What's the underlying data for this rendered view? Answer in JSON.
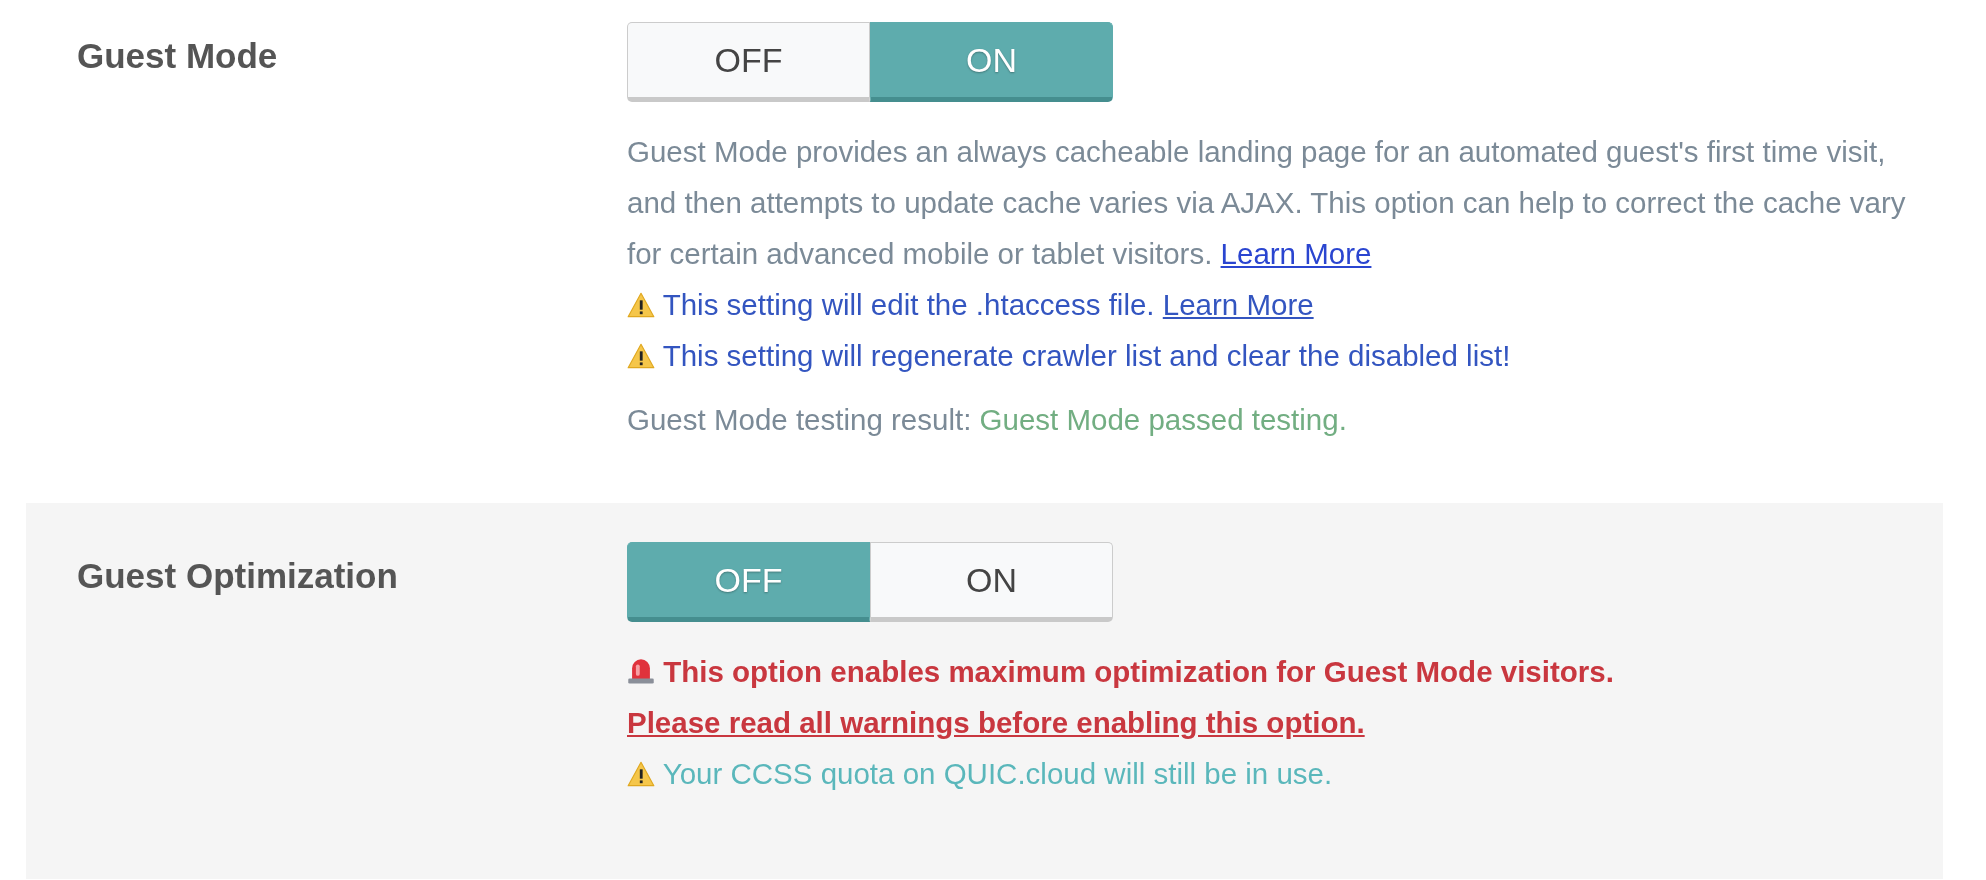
{
  "settings": [
    {
      "label": "Guest Mode",
      "shaded": false,
      "toggle": [
        {
          "label": "OFF",
          "selected": false
        },
        {
          "label": "ON",
          "selected": true
        }
      ],
      "notes": [
        {
          "kind": "description",
          "text": "Guest Mode provides an always cacheable landing page for an automated guest's first time visit, and then attempts to update cache varies via AJAX. This option can help to correct the cache vary for certain advanced mobile or tablet visitors.",
          "link": "Learn More"
        },
        {
          "kind": "warning",
          "text": "This setting will edit the .htaccess file.",
          "link": "Learn More"
        },
        {
          "kind": "warning",
          "text": "This setting will regenerate crawler list and clear the disabled list!"
        },
        {
          "kind": "result",
          "text": "Guest Mode testing result:",
          "value": "Guest Mode passed testing."
        }
      ]
    },
    {
      "label": "Guest Optimization",
      "shaded": true,
      "toggle": [
        {
          "label": "OFF",
          "selected": true
        },
        {
          "label": "ON",
          "selected": false
        }
      ],
      "notes": [
        {
          "kind": "alert",
          "text": "This option enables maximum optimization for Guest Mode visitors.",
          "link": "Please read all warnings before enabling this option."
        },
        {
          "kind": "notice",
          "text": "Your CCSS quota on QUIC.cloud will still be in use."
        }
      ]
    }
  ]
}
